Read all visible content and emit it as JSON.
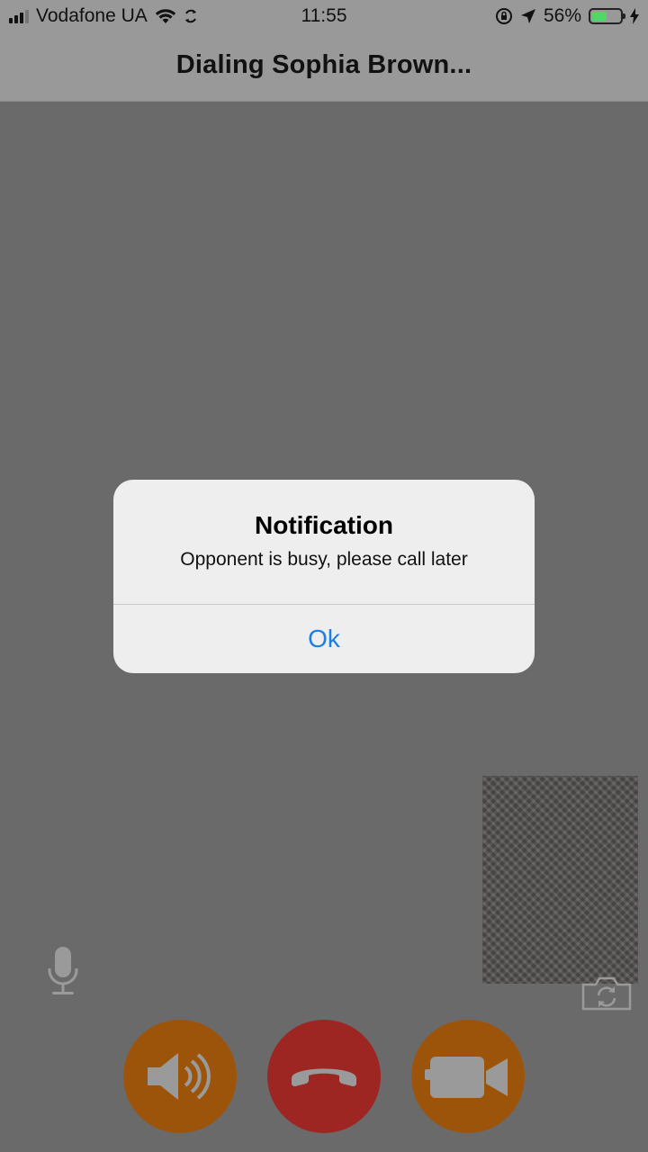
{
  "status_bar": {
    "carrier": "Vodafone UA",
    "time": "11:55",
    "battery_percent": "56%",
    "battery_level": 0.56,
    "battery_color": "#4cd964"
  },
  "nav": {
    "title": "Dialing Sophia Brown..."
  },
  "alert": {
    "title": "Notification",
    "message": "Opponent is busy, please call later",
    "button_label": "Ok",
    "button_color": "#1b7de6"
  },
  "controls": {
    "mic_icon": "microphone-icon",
    "switch_camera_icon": "switch-camera-icon",
    "speaker_icon": "speaker-icon",
    "hangup_icon": "phone-hangup-icon",
    "video_icon": "video-camera-icon",
    "speaker_color": "#9c540b",
    "hangup_color": "#9d2522",
    "video_color": "#9c540b"
  }
}
